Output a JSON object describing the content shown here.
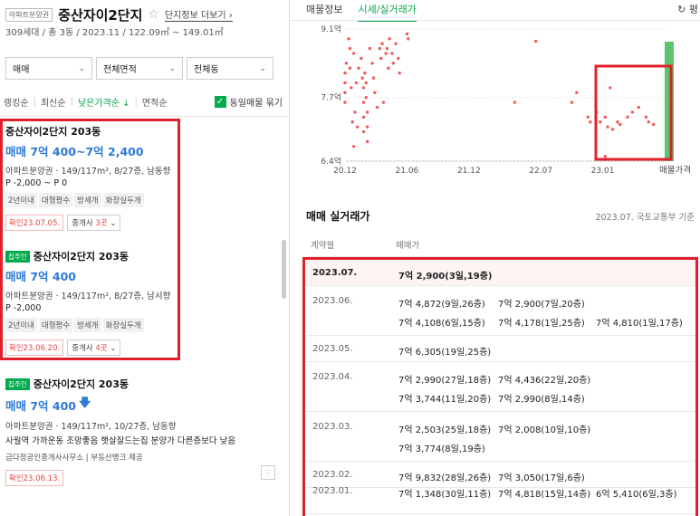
{
  "left": {
    "badge": "아파트분양권",
    "name": "중산자이2단지",
    "more_link": "단지정보 더보기",
    "sub": "309세대 / 총 3동 / 2023.11 / 122.09㎡ ~ 149.01㎡",
    "filters": [
      "매매",
      "전체면적",
      "전체동"
    ],
    "sorts": [
      "랭킹순",
      "최신순",
      "낮은가격순",
      "면적순"
    ],
    "same_listing": "동일매물 묶기",
    "items": [
      {
        "title": "중산자이2단지 203동",
        "price": "매매 7억 400~7억 2,400",
        "desc": "아파트분양권 · 149/117m², 8/27층, 남동향",
        "desc2": "P -2,000 ~ P 0",
        "tags": [
          "2년이내",
          "대형평수",
          "방세개",
          "화장실두개"
        ],
        "confirm": "확인23.07.05.",
        "agent": "중개사 ",
        "agent_count": "3곳"
      },
      {
        "badge": "집주인",
        "title": "중산자이2단지 203동",
        "price": "매매 7억 400",
        "desc": "아파트분양권 · 149/117m², 8/27층, 남서향",
        "desc2": "P -2,000",
        "tags": [
          "2년이내",
          "대형평수",
          "방세개",
          "화장실두개"
        ],
        "confirm": "확인23.06.20.",
        "agent": "중개사 ",
        "agent_count": "4곳"
      },
      {
        "badge": "집주인",
        "title": "중산자이2단지 203동",
        "price": "매매 7억 400",
        "desc": "아파트분양권 · 149/117m², 10/27층, 남동향",
        "desc2": "사월역 가까운동 조망좋음 햇살잘드는집 분양가 다른층보다 낮음",
        "provider": "금다정공인중개사사무소  |  부동산뱅크 제공",
        "confirm": "확인23.06.13."
      }
    ]
  },
  "right": {
    "tabs": [
      "매물정보",
      "시세/실거래가"
    ],
    "top_right": "↻ 평",
    "section_title": "매매 실거래가",
    "section_note": "2023.07. 국토교통부 기준",
    "col_headers": [
      "계약월",
      "매매가"
    ],
    "transactions": [
      {
        "month": "2023.07.",
        "highlight": true,
        "entries": [
          "7억 2,900(3일,19층)"
        ]
      },
      {
        "month": "2023.06.",
        "entries": [
          "7억 4,872(9일,26층)",
          "7억 2,900(7일,20층)",
          "7억 4,108(6일,15층)",
          "7억 4,178(1일,25층)",
          "7억 4,810(1일,17층)"
        ]
      },
      {
        "month": "2023.05.",
        "entries": [
          "7억 6,305(19일,25층)"
        ]
      },
      {
        "month": "2023.04.",
        "entries": [
          "7억 2,990(27일,18층)",
          "7억 4,436(22일,20층)",
          "7억 3,744(11일,20층)",
          "7억 2,990(8일,14층)"
        ]
      },
      {
        "month": "2023.03.",
        "entries": [
          "7억 2,503(25일,18층)",
          "7억 2,008(10일,10층)",
          "7억 3,774(8일,19층)"
        ]
      },
      {
        "month": "2023.02.",
        "entries": [
          "7억 9,832(28일,26층)",
          "7억 3,050(17일,6층)"
        ]
      },
      {
        "month": "2023.01.",
        "entries": [
          "7억 1,348(30일,11층)",
          "7억 4,818(15일,14층)",
          "6억 5,410(6일,3층)"
        ]
      }
    ]
  },
  "chart_data": {
    "type": "scatter",
    "y_tick_labels": [
      "9.1억",
      "7.7억",
      "6.4억"
    ],
    "y_ticks": [
      9.1,
      7.7,
      6.4
    ],
    "ylim": [
      6.4,
      9.1
    ],
    "x_tick_labels": [
      "20.12",
      "21.06",
      "21.12",
      "22.07",
      "23.01"
    ],
    "x_ticks": [
      2020.92,
      2021.42,
      2021.92,
      2022.5,
      2023.0
    ],
    "xlim": [
      2020.92,
      2023.5
    ],
    "legend": "매물가격",
    "series": [
      {
        "color": "#f05a5a",
        "points": [
          [
            2020.92,
            8.2
          ],
          [
            2020.92,
            8.0
          ],
          [
            2020.92,
            7.8
          ],
          [
            2020.92,
            7.6
          ],
          [
            2020.93,
            8.4
          ],
          [
            2020.95,
            8.9
          ],
          [
            2020.96,
            8.7
          ],
          [
            2020.96,
            8.3
          ],
          [
            2020.97,
            7.9
          ],
          [
            2020.98,
            7.2
          ],
          [
            2020.99,
            6.7
          ],
          [
            2020.99,
            8.6
          ],
          [
            2021.0,
            7.4
          ],
          [
            2021.01,
            8.0
          ],
          [
            2021.02,
            7.1
          ],
          [
            2021.03,
            8.3
          ],
          [
            2021.05,
            8.5
          ],
          [
            2021.06,
            8.1
          ],
          [
            2021.07,
            7.9
          ],
          [
            2021.07,
            7.6
          ],
          [
            2021.07,
            7.3
          ],
          [
            2021.07,
            7.0
          ],
          [
            2021.08,
            8.2
          ],
          [
            2021.09,
            8.0
          ],
          [
            2021.09,
            7.7
          ],
          [
            2021.1,
            7.4
          ],
          [
            2021.1,
            7.1
          ],
          [
            2021.1,
            6.8
          ],
          [
            2021.12,
            8.7
          ],
          [
            2021.14,
            8.4
          ],
          [
            2021.15,
            8.1
          ],
          [
            2021.16,
            7.8
          ],
          [
            2021.18,
            7.5
          ],
          [
            2021.2,
            8.7
          ],
          [
            2021.21,
            8.5
          ],
          [
            2021.22,
            8.8
          ],
          [
            2021.23,
            7.6
          ],
          [
            2021.25,
            8.6
          ],
          [
            2021.26,
            8.7
          ],
          [
            2021.27,
            8.3
          ],
          [
            2021.28,
            8.9
          ],
          [
            2021.3,
            8.6
          ],
          [
            2021.31,
            8.4
          ],
          [
            2021.33,
            8.8
          ],
          [
            2021.35,
            8.5
          ],
          [
            2021.36,
            8.2
          ],
          [
            2021.42,
            9.0
          ],
          [
            2021.43,
            8.9
          ],
          [
            2022.29,
            7.6
          ],
          [
            2022.46,
            8.85
          ],
          [
            2022.75,
            7.6
          ],
          [
            2022.79,
            7.8
          ],
          [
            2022.88,
            7.3
          ],
          [
            2022.9,
            7.2
          ],
          [
            2022.95,
            7.4
          ],
          [
            2022.98,
            7.2
          ],
          [
            2023.02,
            7.3
          ],
          [
            2023.04,
            7.1
          ],
          [
            2023.06,
            7.9
          ],
          [
            2023.08,
            7.05
          ],
          [
            2023.12,
            7.2
          ],
          [
            2023.14,
            7.15
          ],
          [
            2023.2,
            7.3
          ],
          [
            2023.24,
            7.4
          ],
          [
            2023.29,
            7.5
          ],
          [
            2023.35,
            7.3
          ],
          [
            2023.37,
            7.2
          ],
          [
            2023.41,
            7.15
          ],
          [
            2023.02,
            6.5
          ]
        ]
      }
    ]
  }
}
